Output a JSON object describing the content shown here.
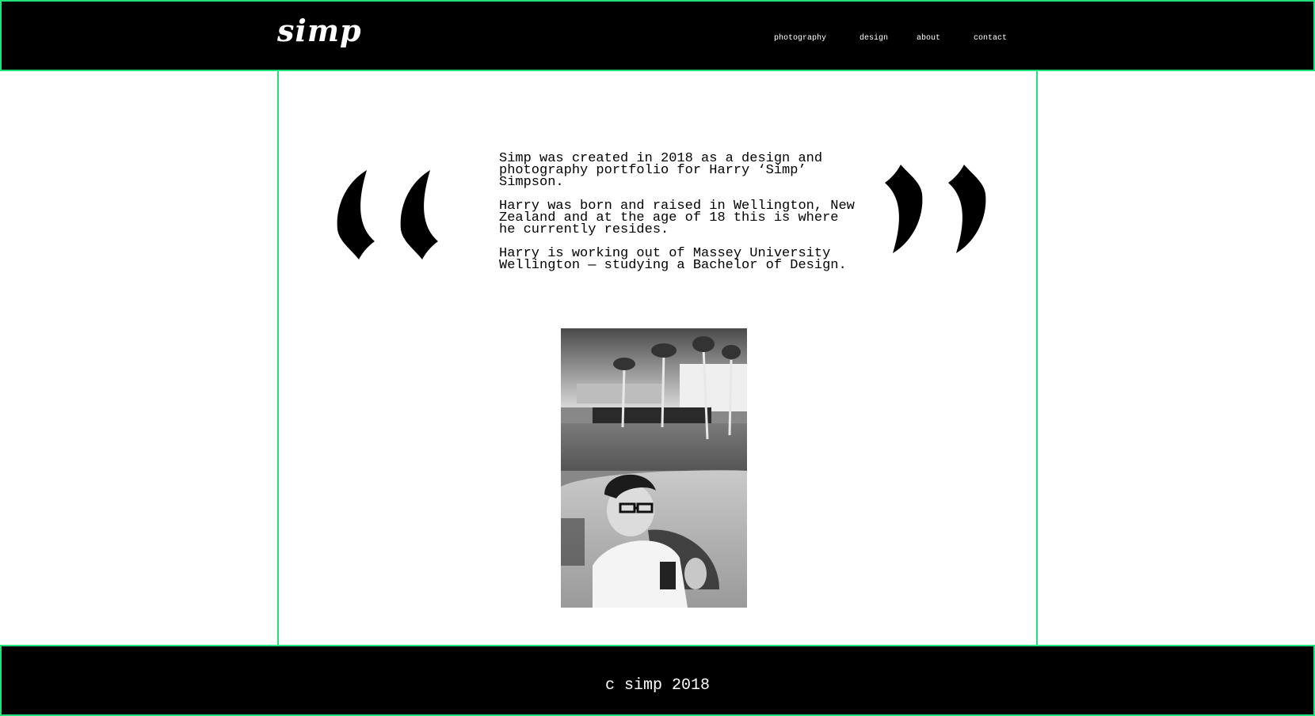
{
  "header": {
    "logo": "simp",
    "nav": [
      {
        "label": "photography"
      },
      {
        "label": "design"
      },
      {
        "label": "about"
      },
      {
        "label": "contact"
      }
    ]
  },
  "about": {
    "paragraphs": [
      "Simp was created in 2018 as a design and photography portfolio for Harry ‘Simp’ Simpson.",
      "Harry was born and raised in Wellington, New Zealand and at the age of 18 this is where he currently resides.",
      "Harry is working out of Massey University Wellington — studying a Bachelor of Design."
    ]
  },
  "footer": {
    "copyright": "c simp 2018"
  },
  "colors": {
    "accent": "#22e07a",
    "bar": "#000000",
    "page": "#ffffff"
  },
  "icons": {
    "open_quote": "opening-quote-icon",
    "close_quote": "closing-quote-icon"
  }
}
